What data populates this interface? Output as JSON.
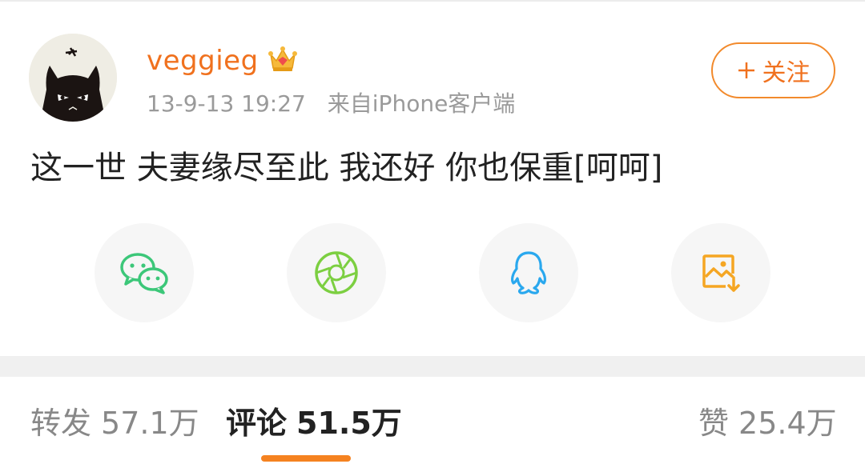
{
  "post": {
    "username": "veggieg",
    "timestamp": "13-9-13 19:27",
    "source": "来自iPhone客户端",
    "text": "这一世 夫妻缘尽至此 我还好 你也保重[呵呵]",
    "follow_label": "关注"
  },
  "share": [
    {
      "name": "wechat-icon",
      "color": "#3cc779"
    },
    {
      "name": "moments-shutter-icon",
      "color": "#7ccf41"
    },
    {
      "name": "qq-icon",
      "color": "#2aa8ee"
    },
    {
      "name": "save-image-icon",
      "color": "#f5a623"
    }
  ],
  "tabs": {
    "repost": {
      "label": "转发",
      "count": "57.1万"
    },
    "comments": {
      "label": "评论",
      "count": "51.5万"
    },
    "likes": {
      "label": "赞",
      "count": "25.4万"
    }
  },
  "colors": {
    "accent": "#f0711e",
    "underline": "#f58220"
  }
}
